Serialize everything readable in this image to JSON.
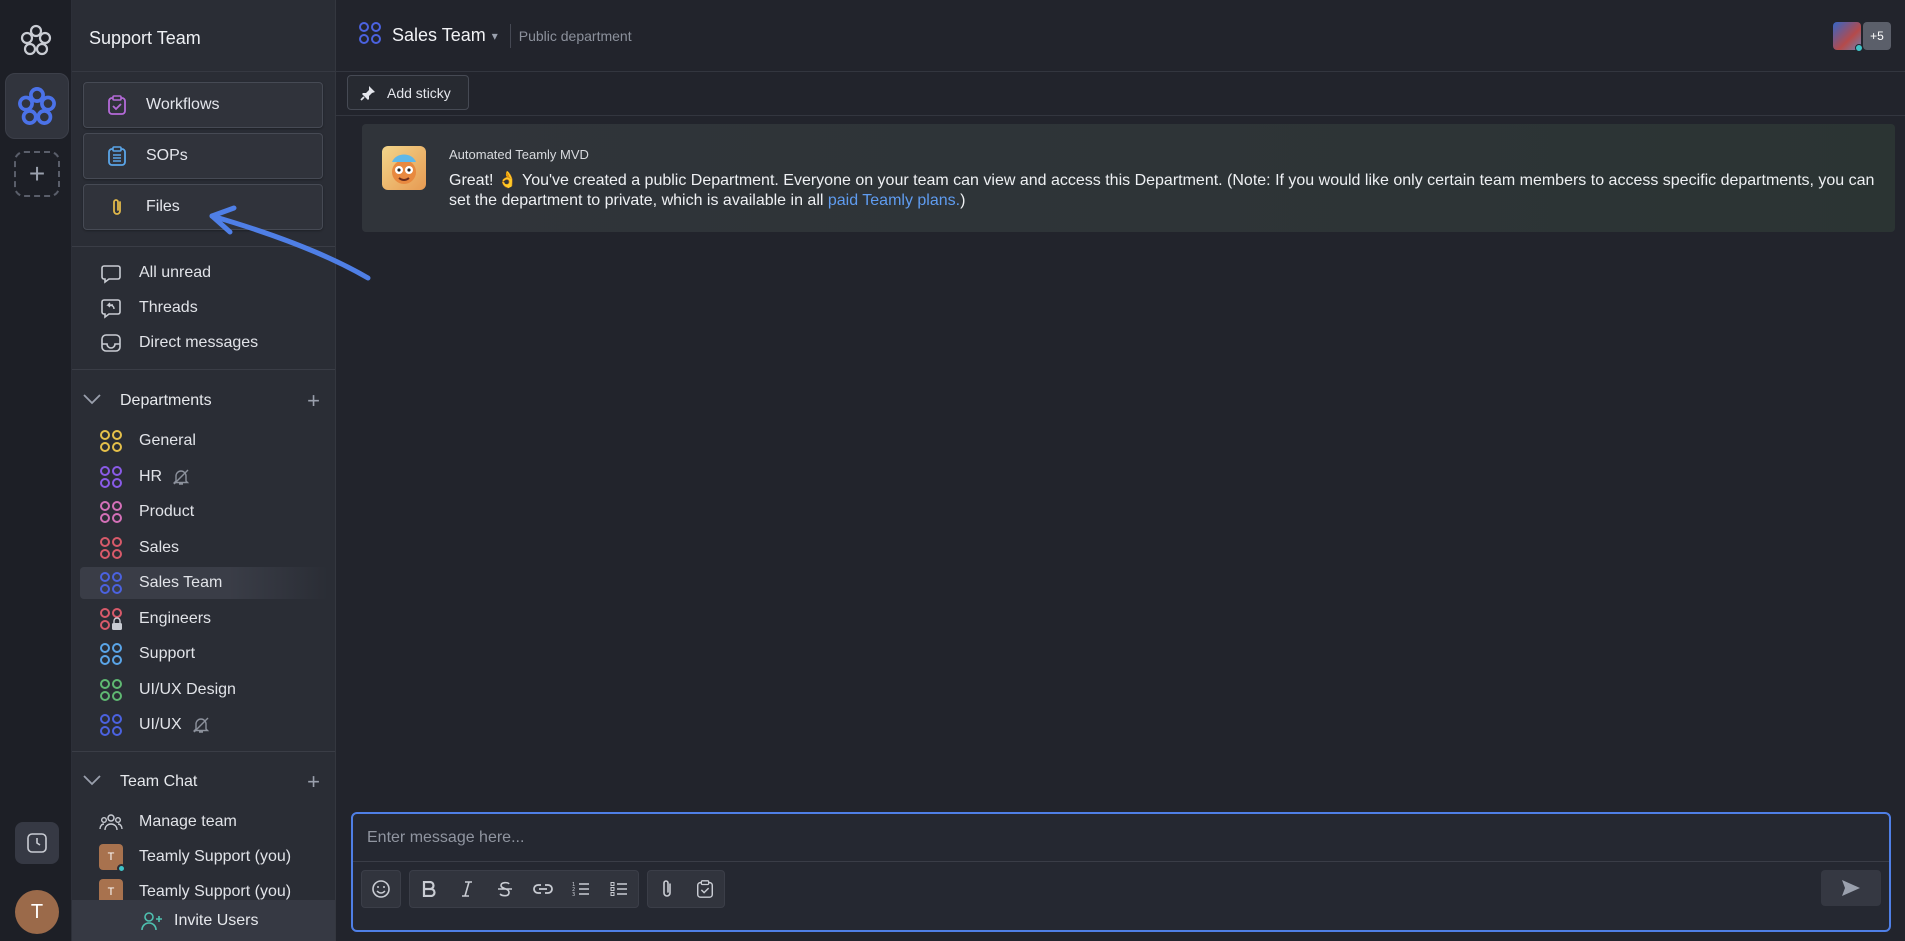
{
  "workspace": {
    "name": "Support Team",
    "user_initial": "T"
  },
  "sidebar": {
    "title": "Support Team",
    "quick": [
      {
        "label": "Workflows",
        "icon": "workflows-icon"
      },
      {
        "label": "SOPs",
        "icon": "sops-icon"
      },
      {
        "label": "Files",
        "icon": "paperclip-icon"
      }
    ],
    "nav": [
      {
        "label": "All unread",
        "icon": "chat-bubble-icon"
      },
      {
        "label": "Threads",
        "icon": "threads-icon"
      },
      {
        "label": "Direct messages",
        "icon": "inbox-icon"
      }
    ],
    "departments_label": "Departments",
    "departments": [
      {
        "label": "General",
        "color": "#e5c04a",
        "muted": false,
        "active": false,
        "locked": false
      },
      {
        "label": "HR",
        "color": "#8a5be8",
        "muted": true,
        "active": false,
        "locked": false
      },
      {
        "label": "Product",
        "color": "#d470b8",
        "muted": false,
        "active": false,
        "locked": false
      },
      {
        "label": "Sales",
        "color": "#d85a6a",
        "muted": false,
        "active": false,
        "locked": false
      },
      {
        "label": "Sales Team",
        "color": "#4b62e0",
        "muted": false,
        "active": true,
        "locked": false
      },
      {
        "label": "Engineers",
        "color": "#d85a6a",
        "muted": false,
        "active": false,
        "locked": true
      },
      {
        "label": "Support",
        "color": "#5aa5e8",
        "muted": false,
        "active": false,
        "locked": false
      },
      {
        "label": "UI/UX Design",
        "color": "#5fb872",
        "muted": false,
        "active": false,
        "locked": false
      },
      {
        "label": "UI/UX",
        "color": "#4b62e0",
        "muted": true,
        "active": false,
        "locked": false
      }
    ],
    "team_chat_label": "Team Chat",
    "team_chat": [
      {
        "label": "Manage team"
      },
      {
        "label": "Teamly Support (you)",
        "initial": "T"
      },
      {
        "label": "Teamly Support (you)",
        "initial": "T"
      }
    ],
    "invite_label": "Invite Users"
  },
  "header": {
    "title": "Sales Team",
    "subtitle": "Public department",
    "more_members": "+5"
  },
  "toolbar": {
    "add_sticky": "Add sticky"
  },
  "message": {
    "author": "Automated Teamly MVD",
    "text_before": "Great! 👌 You've created a public Department. Everyone on your team can view and access this Department. (Note: If you would like only certain team members to access specific departments, you can set the department to private, which is available in all ",
    "link": "paid Teamly plans.",
    "text_after": ")"
  },
  "composer": {
    "placeholder": "Enter message here..."
  },
  "colors": {
    "accent": "#4f7fe6",
    "link": "#5f9cf0"
  }
}
